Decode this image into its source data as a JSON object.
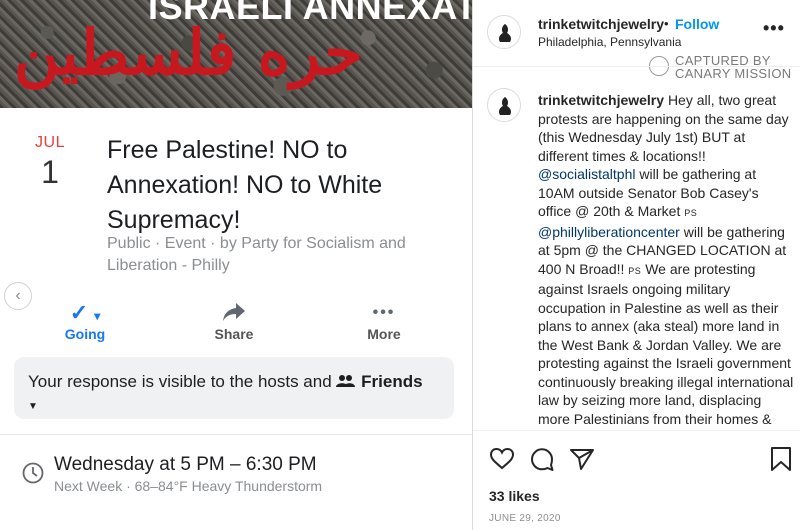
{
  "event": {
    "banner_title": "ISRAELI ANNEXATION",
    "banner_arabic": "حره فلسطين",
    "date_month": "JUL",
    "date_day": "1",
    "title": "Free Palestine! NO to Annexation! NO to White Supremacy!",
    "meta": "Public · Event · by Party for Socialism and Liberation - Philly",
    "actions": {
      "going": "Going",
      "share": "Share",
      "more": "More"
    },
    "response_text": "Your response is visible to the hosts and",
    "response_audience": "Friends",
    "time_main": "Wednesday at 5 PM – 6:30 PM",
    "time_sub": "Next Week · 68–84°F Heavy Thunderstorm"
  },
  "post": {
    "username": "trinketwitchjewelry",
    "dot": "•",
    "follow_label": "Follow",
    "location": "Philadelphia, Pennsylvania",
    "more_label": "•••",
    "watermark": "CAPTURED BY CANARY MISSION",
    "comment": {
      "username": "trinketwitchjewelry",
      "part1": "Hey all, two great protests are happening on the same day (this Wednesday July 1st) BUT at different times & locations!!",
      "mention1": "@socialistaltphl",
      "part2": "will be gathering at 10AM outside Senator Bob Casey's office @ 20th & Market",
      "ps1": "PS",
      "mention2": "@phillyliberationcenter",
      "part3": "will be gathering at 5pm @ the CHANGED LOCATION at 400 N Broad!!",
      "ps2": "PS",
      "part4": "We are protesting against Israels ongoing military occupation in Palestine as well as their plans to annex (aka steal) more land in the West Bank & Jordan Valley. We are protesting against the Israeli government continuously breaking illegal international law by seizing more land, displacing more Palestinians from their homes & land that has belonged to their families for generations. We will"
    },
    "likes": "33 likes",
    "date": "JUNE 29, 2020"
  },
  "colors": {
    "facebook_blue": "#1877f2",
    "instagram_blue": "#0095f6",
    "month_red": "#e8413d",
    "arabic_red": "#c8181f"
  },
  "icons": [
    "check-icon",
    "share-arrow-icon",
    "more-dots-icon",
    "friends-icon",
    "clock-icon",
    "heart-icon",
    "comment-icon",
    "send-icon",
    "bookmark-icon",
    "chevron-left-icon"
  ]
}
